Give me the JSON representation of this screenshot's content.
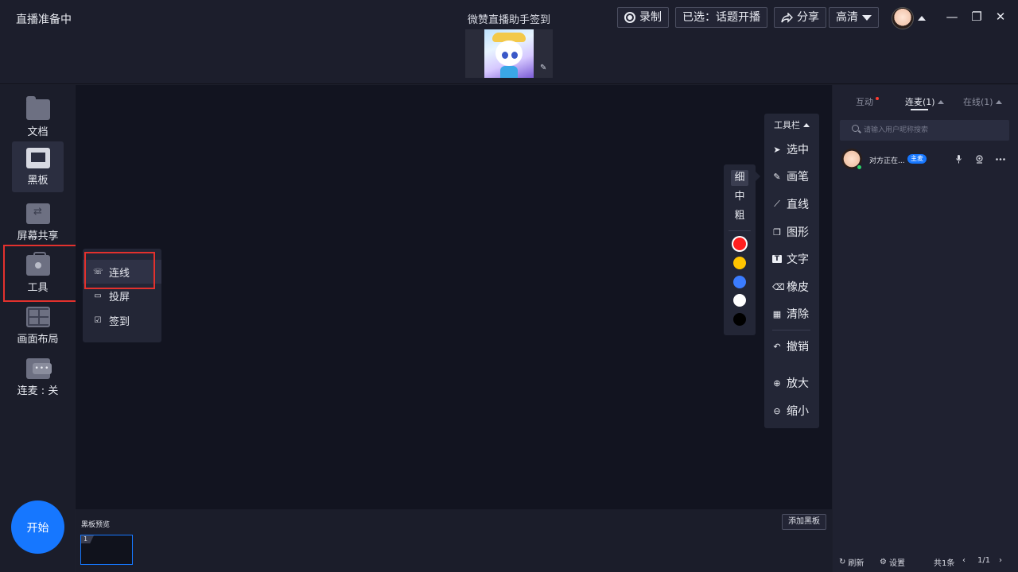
{
  "app": {
    "status": "直播准备中",
    "live_title": "微赞直播助手签到"
  },
  "header": {
    "record_label": "录制",
    "selected_topic": "已选：话题开播",
    "share_label": "分享",
    "quality_label": "高清",
    "corner_glyph": "✎"
  },
  "window": {
    "minimize": "—",
    "restore": "❐",
    "close": "✕"
  },
  "sidebar": {
    "items": [
      {
        "label": "文档",
        "icon": "folder-icon"
      },
      {
        "label": "黑板",
        "icon": "blackboard-icon"
      },
      {
        "label": "屏幕共享",
        "icon": "screen-share-icon"
      },
      {
        "label": "工具",
        "icon": "toolbox-icon"
      },
      {
        "label": "画面布局",
        "icon": "layout-icon"
      },
      {
        "label": "连麦 : 关",
        "icon": "chat-icon"
      }
    ],
    "start_label": "开始"
  },
  "tools_menu": {
    "items": [
      {
        "label": "连线",
        "icon": "phone-link-icon",
        "glyph": "☏"
      },
      {
        "label": "投屏",
        "icon": "cast-screen-icon",
        "glyph": "▭"
      },
      {
        "label": "签到",
        "icon": "checkin-icon",
        "glyph": "☑"
      }
    ]
  },
  "draw_toolbar": {
    "title": "工具栏",
    "items": [
      {
        "label": "选中",
        "glyph": "➤"
      },
      {
        "label": "画笔",
        "glyph": "✎"
      },
      {
        "label": "直线",
        "glyph": "⟋"
      },
      {
        "label": "图形",
        "glyph": "❐"
      },
      {
        "label": "文字",
        "glyph": "T"
      },
      {
        "label": "橡皮",
        "glyph": "⌫"
      },
      {
        "label": "清除",
        "glyph": "▦"
      },
      {
        "label": "撤销",
        "glyph": "↶"
      },
      {
        "label": "放大",
        "glyph": "⊕"
      },
      {
        "label": "缩小",
        "glyph": "⊖"
      }
    ]
  },
  "pen_panel": {
    "sizes": [
      "细",
      "中",
      "粗"
    ],
    "selected_size": "细",
    "colors": [
      "#ff1f1f",
      "#ffc400",
      "#3b7cff",
      "#ffffff",
      "#000000"
    ],
    "selected_color": "#ff1f1f"
  },
  "preview": {
    "label": "黑板预览",
    "add_label": "添加黑板",
    "thumb_number": "1"
  },
  "right_panel": {
    "tabs": [
      {
        "label": "互动"
      },
      {
        "label": "连麦(1)"
      },
      {
        "label": "在线(1)"
      }
    ],
    "search_placeholder": "请输入用户昵称搜索",
    "user": {
      "name": "对方正在...",
      "badge": "主麦"
    },
    "footer": {
      "refresh": "刷新",
      "settings": "设置",
      "total": "共1条",
      "page": "1/1"
    }
  }
}
